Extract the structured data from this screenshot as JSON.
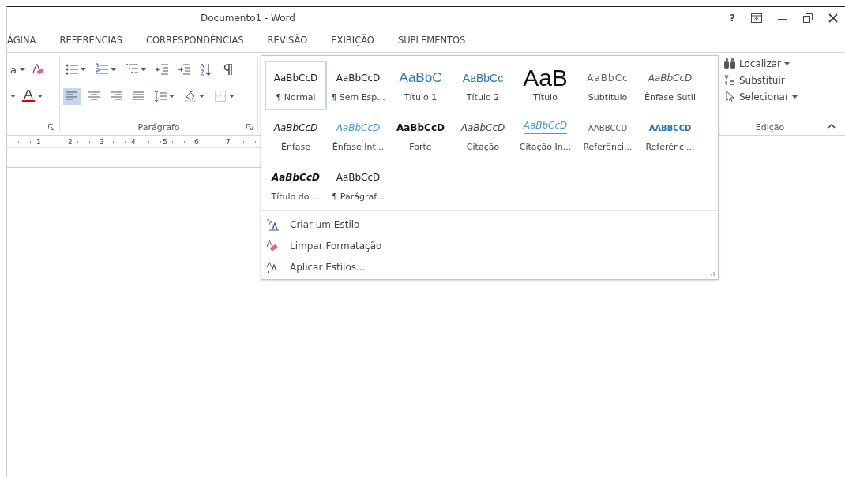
{
  "window": {
    "title": "Documento1 - Word",
    "help": "?"
  },
  "tabs": [
    {
      "label": "ÁGINA",
      "selected": false
    },
    {
      "label": "REFERÊNCIAS",
      "selected": false
    },
    {
      "label": "CORRESPONDÊNCIAS",
      "selected": false
    },
    {
      "label": "REVISÃO",
      "selected": false
    },
    {
      "label": "EXIBIÇÃO",
      "selected": false
    },
    {
      "label": "SUPLEMENTOS",
      "selected": false
    }
  ],
  "font_group": {
    "case_button": "a"
  },
  "paragraph_group": {
    "label": "Parágrafo",
    "row1": [
      {
        "kind": "bullets",
        "dropdown": true,
        "selected": false
      },
      {
        "kind": "numbering",
        "dropdown": true,
        "selected": false
      },
      {
        "kind": "multilevel",
        "dropdown": true,
        "selected": false
      },
      {
        "kind": "outdent",
        "dropdown": false,
        "selected": false
      },
      {
        "kind": "indent",
        "dropdown": false,
        "selected": false
      },
      {
        "kind": "sort",
        "dropdown": false,
        "selected": false
      },
      {
        "kind": "pilcrow",
        "dropdown": false,
        "selected": false
      }
    ],
    "row2": [
      {
        "kind": "align-left",
        "dropdown": false,
        "selected": true
      },
      {
        "kind": "align-center",
        "dropdown": false,
        "selected": false
      },
      {
        "kind": "align-right",
        "dropdown": false,
        "selected": false
      },
      {
        "kind": "justify",
        "dropdown": false,
        "selected": false
      },
      {
        "kind": "spacing",
        "dropdown": true,
        "selected": false
      },
      {
        "kind": "shading",
        "dropdown": true,
        "selected": false
      },
      {
        "kind": "borders",
        "dropdown": true,
        "selected": false
      }
    ]
  },
  "edit_group": {
    "label": "Edição",
    "items": [
      {
        "kind": "find",
        "label": "Localizar",
        "dropdown": true
      },
      {
        "kind": "replace",
        "label": "Substituir",
        "dropdown": false
      },
      {
        "kind": "select",
        "label": "Selecionar",
        "dropdown": true
      }
    ]
  },
  "ruler": {
    "marks": [
      "1",
      "2",
      "3",
      "4",
      "5",
      "6",
      "7"
    ]
  },
  "style_gallery": {
    "styles": [
      {
        "sample": "AaBbCcD",
        "label": "¶ Normal",
        "kind": "normal",
        "selected": true
      },
      {
        "sample": "AaBbCcD",
        "label": "¶ Sem Esp...",
        "kind": "normal",
        "selected": false
      },
      {
        "sample": "AaBbC",
        "label": "Título 1",
        "kind": "heading1",
        "selected": false
      },
      {
        "sample": "AaBbCc",
        "label": "Título 2",
        "kind": "heading2",
        "selected": false
      },
      {
        "sample": "AaB",
        "label": "Título",
        "kind": "title",
        "selected": false
      },
      {
        "sample": "AaBbCc",
        "label": "Subtítulo",
        "kind": "subtitle",
        "selected": false
      },
      {
        "sample": "AaBbCcD",
        "label": "Ênfase Sutil",
        "kind": "subtle",
        "selected": false
      },
      {
        "sample": "AaBbCcD",
        "label": "Ênfase",
        "kind": "emphasis",
        "selected": false
      },
      {
        "sample": "AaBbCcD",
        "label": "Ênfase Int...",
        "kind": "intense-emphasis",
        "selected": false
      },
      {
        "sample": "AaBbCcD",
        "label": "Forte",
        "kind": "strong",
        "selected": false
      },
      {
        "sample": "AaBbCcD",
        "label": "Citação",
        "kind": "quote",
        "selected": false
      },
      {
        "sample": "AaBbCcD",
        "label": "Citação In...",
        "kind": "intense-quote",
        "selected": false
      },
      {
        "sample": "AABBCCD",
        "label": "Referênci...",
        "kind": "reference",
        "selected": false
      },
      {
        "sample": "AABBCCD",
        "label": "Referênci...",
        "kind": "intense-reference",
        "selected": false
      },
      {
        "sample": "AaBbCcD",
        "label": "Título do ...",
        "kind": "book",
        "selected": false
      },
      {
        "sample": "AaBbCcD",
        "label": "¶ Parágraf...",
        "kind": "normal",
        "selected": false
      }
    ],
    "menu": [
      {
        "kind": "new",
        "label": "Criar um Estilo"
      },
      {
        "kind": "clear",
        "label": "Limpar Formatação"
      },
      {
        "kind": "apply",
        "label": "Aplicar Estilos..."
      }
    ]
  }
}
